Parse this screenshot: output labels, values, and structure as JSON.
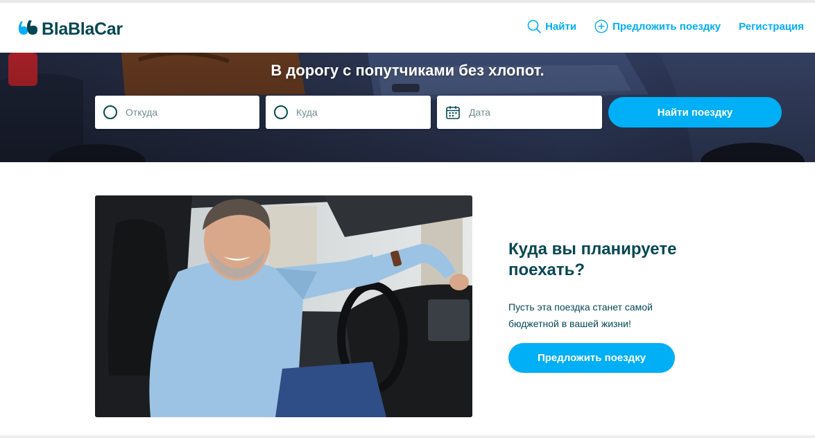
{
  "brand": {
    "name": "BlaBlaCar",
    "color": "#054752",
    "accent": "#00aff5"
  },
  "nav": {
    "search_label": "Найти",
    "offer_label": "Предложить поездку",
    "register_label": "Регистрация"
  },
  "hero": {
    "title": "В дорогу с попутчиками без хлопот.",
    "from_placeholder": "Откуда",
    "to_placeholder": "Куда",
    "date_placeholder": "Дата",
    "search_button": "Найти поездку"
  },
  "promo": {
    "heading": "Куда вы планируете поехать?",
    "text": "Пусть эта поездка станет самой бюджетной в вашей жизни!",
    "button": "Предложить поездку"
  },
  "icons": {
    "logo": "blablacar-logo-icon",
    "search": "search-icon",
    "plus": "plus-circle-icon",
    "origin": "circle-icon",
    "destination": "circle-icon",
    "date": "calendar-icon"
  }
}
